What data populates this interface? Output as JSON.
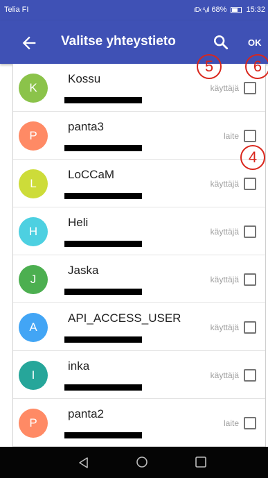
{
  "status_bar": {
    "carrier": "Telia FI",
    "icons": "ıD‹ ⁴₆ıl",
    "battery": "68%",
    "time": "15:32"
  },
  "app_bar": {
    "title": "Valitse yhteystieto",
    "ok_label": "OK",
    "back_icon": "arrow-left-icon",
    "search_icon": "search-icon"
  },
  "contacts": [
    {
      "initial": "K",
      "name": "Kossu",
      "type": "käyttäjä",
      "color": "#8bc34a"
    },
    {
      "initial": "P",
      "name": "panta3",
      "type": "laite",
      "color": "#ff8a65"
    },
    {
      "initial": "L",
      "name": "LoCCaM",
      "type": "käyttäjä",
      "color": "#cddc39"
    },
    {
      "initial": "H",
      "name": "Heli",
      "type": "käyttäjä",
      "color": "#4dd0e1"
    },
    {
      "initial": "J",
      "name": "Jaska",
      "type": "käyttäjä",
      "color": "#4caf50"
    },
    {
      "initial": "A",
      "name": "API_ACCESS_USER",
      "type": "käyttäjä",
      "color": "#42a5f5"
    },
    {
      "initial": "I",
      "name": "inka",
      "type": "käyttäjä",
      "color": "#26a69a"
    },
    {
      "initial": "P",
      "name": "panta2",
      "type": "laite",
      "color": "#ff8a65"
    }
  ],
  "callouts": {
    "search": "5",
    "ok": "6",
    "checkbox": "4"
  },
  "nav_bar": {
    "back_icon": "nav-back-icon",
    "home_icon": "nav-home-icon",
    "recents_icon": "nav-recents-icon"
  },
  "colors": {
    "primary": "#3f51b5",
    "annotation": "#d9261c"
  }
}
